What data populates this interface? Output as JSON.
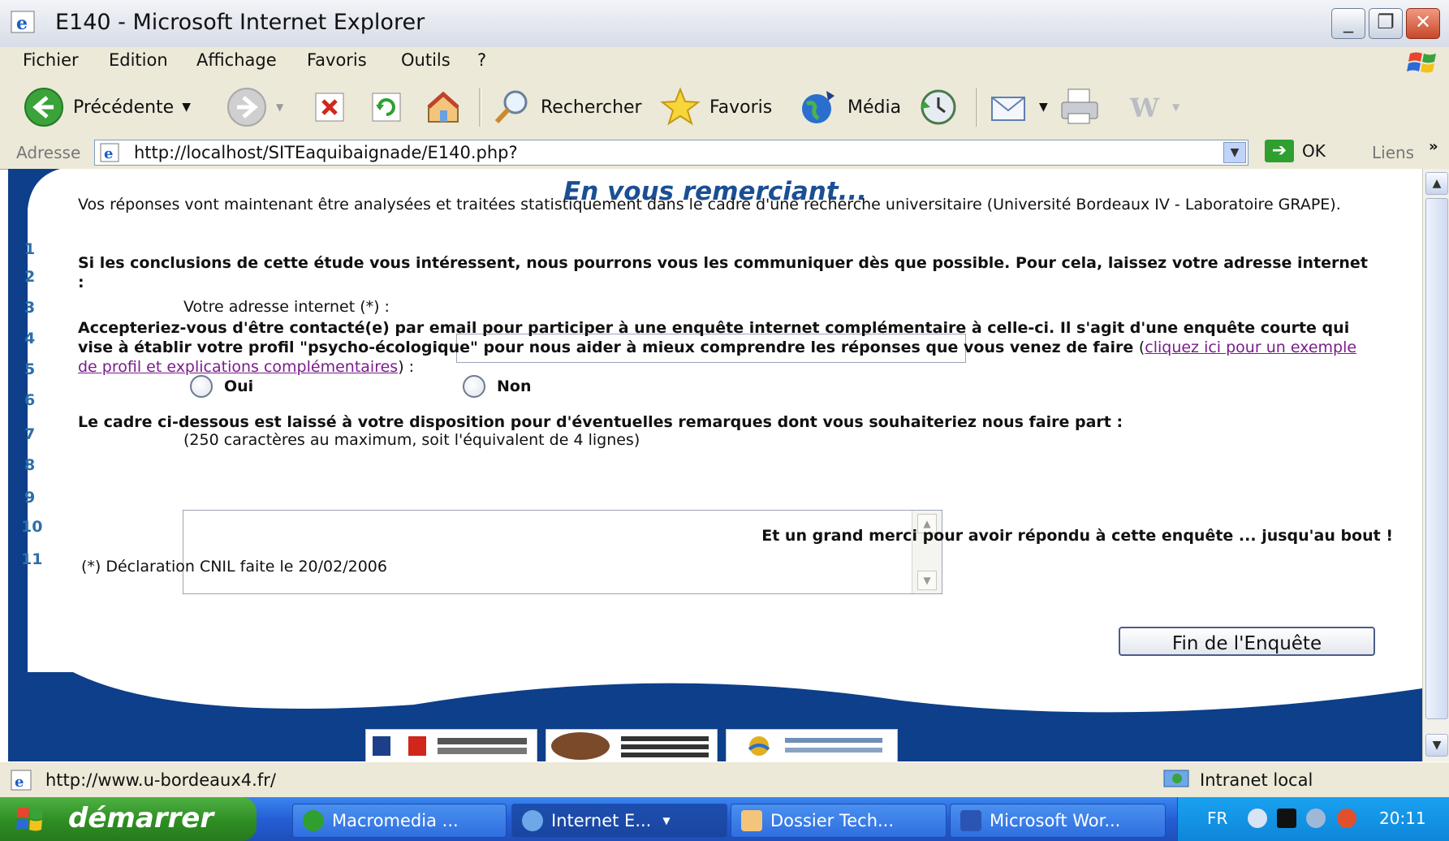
{
  "window": {
    "title": "E140 - Microsoft Internet Explorer"
  },
  "menu": {
    "items": [
      "Fichier",
      "Edition",
      "Affichage",
      "Favoris",
      "Outils",
      "?"
    ]
  },
  "toolbar": {
    "back": "Précédente",
    "search": "Rechercher",
    "favorites": "Favoris",
    "media": "Média"
  },
  "address": {
    "label": "Adresse",
    "url": "http://localhost/SITEaquibaignade/E140.php?",
    "go": "OK",
    "links": "Liens",
    "more": "»"
  },
  "page": {
    "heading": "En vous remerciant...",
    "steps": [
      "1",
      "2",
      "3",
      "4",
      "5",
      "6",
      "7",
      "8",
      "9",
      "10",
      "11"
    ],
    "intro": "Vos réponses vont maintenant être analysées et traitées statistiquement dans le cadre d'une recherche universitaire (Université Bordeaux IV - Laboratoire GRAPE).",
    "conclusions": "Si les conclusions de cette étude vous intéressent, nous pourrons vous les communiquer dès que possible. Pour cela, laissez votre adresse internet :",
    "email_label": "Votre adresse internet (*) :",
    "email_value": "",
    "contact_question": "Accepteriez-vous d'être contacté(e) par email pour participer à une enquête internet complémentaire à celle-ci. Il s'agit d'une enquête courte qui vise à établir votre profil \"psycho-écologique\" pour nous aider à mieux comprendre les réponses que vous venez de faire",
    "contact_link": "cliquez ici pour un exemple de profil et explications complémentaires",
    "contact_suffix": " :",
    "radio_yes": "Oui",
    "radio_no": "Non",
    "remarks_label": "Le cadre ci-dessous est laissé à votre disposition pour d'éventuelles remarques dont vous souhaiteriez nous faire part :",
    "remarks_hint": "(250 caractères au maximum, soit l'équivalent de 4 lignes)",
    "remarks_value": "",
    "thanks": "Et un grand merci pour avoir répondu à cette enquête ... jusqu'au bout !",
    "cnil": "(*) Déclaration CNIL faite le 20/02/2006",
    "finish_button": "Fin de l'Enquête"
  },
  "statusbar": {
    "url": "http://www.u-bordeaux4.fr/",
    "zone": "Intranet local"
  },
  "taskbar": {
    "start": "démarrer",
    "tasks": [
      "Macromedia ...",
      "Internet E...",
      "Dossier Tech...",
      "Microsoft Wor..."
    ],
    "language": "FR",
    "clock": "20:11"
  },
  "colors": {
    "heading": "#1b4f93",
    "rail": "#0d3f8a",
    "link": "#7a1d8b",
    "taskbar": "#245ed6",
    "start": "#2e8d23"
  }
}
